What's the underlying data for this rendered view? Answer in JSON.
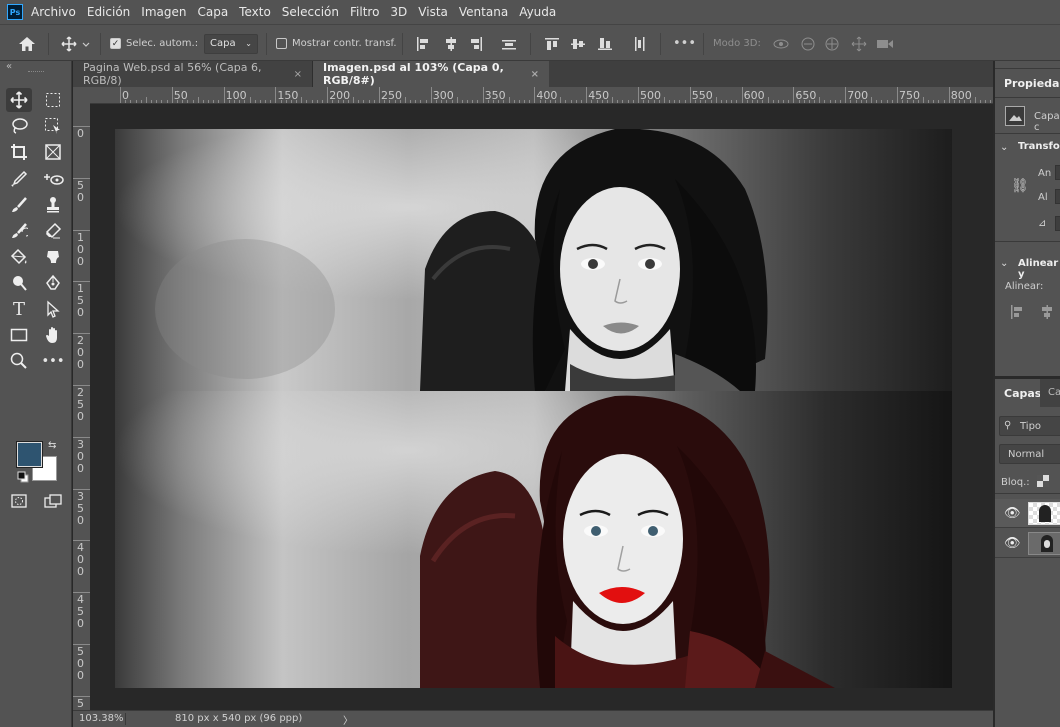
{
  "app": {
    "logo": "Ps"
  },
  "menu": [
    "Archivo",
    "Edición",
    "Imagen",
    "Capa",
    "Texto",
    "Selección",
    "Filtro",
    "3D",
    "Vista",
    "Ventana",
    "Ayuda"
  ],
  "options": {
    "auto_select_label": "Selec. autom.:",
    "auto_select_value": "Capa",
    "show_transform_label": "Mostrar contr. transf.",
    "more": "•••",
    "mode3d_label": "Modo 3D:"
  },
  "tabs": [
    {
      "label": "Pagina Web.psd al 56% (Capa 6, RGB/8)",
      "close": "×"
    },
    {
      "label": "Imagen.psd al 103% (Capa 0, RGB/8#)",
      "close": "×"
    }
  ],
  "ruler": {
    "h_labels": [
      "0",
      "50",
      "100",
      "150",
      "200",
      "250",
      "300",
      "350",
      "400",
      "450",
      "500",
      "550",
      "600",
      "650",
      "700",
      "750",
      "800"
    ],
    "v_labels": [
      "0",
      "5\n0",
      "1\n0\n0",
      "1\n5\n0",
      "2\n0\n0",
      "2\n5\n0",
      "3\n0\n0",
      "3\n5\n0",
      "4\n0\n0",
      "4\n5\n0",
      "5\n0\n0",
      "5"
    ]
  },
  "status": {
    "zoom": "103.38%",
    "doc_info": "810 px x 540 px (96 ppp)",
    "arrow": "〉"
  },
  "properties": {
    "title": "Propiedades",
    "layer_label": "Capa c",
    "transform_label": "Transfor",
    "width_label": "An",
    "height_label": "Al",
    "align_section": "Alinear y",
    "align_label": "Alinear:"
  },
  "layers": {
    "tab_layers": "Capas",
    "tab_other": "Ca",
    "filter_label": "Tipo",
    "blend_mode": "Normal",
    "lock_label": "Bloq.:"
  },
  "colors": {
    "foreground": "#2e5470",
    "background": "#ffffff",
    "accent": "#31a8ff"
  }
}
